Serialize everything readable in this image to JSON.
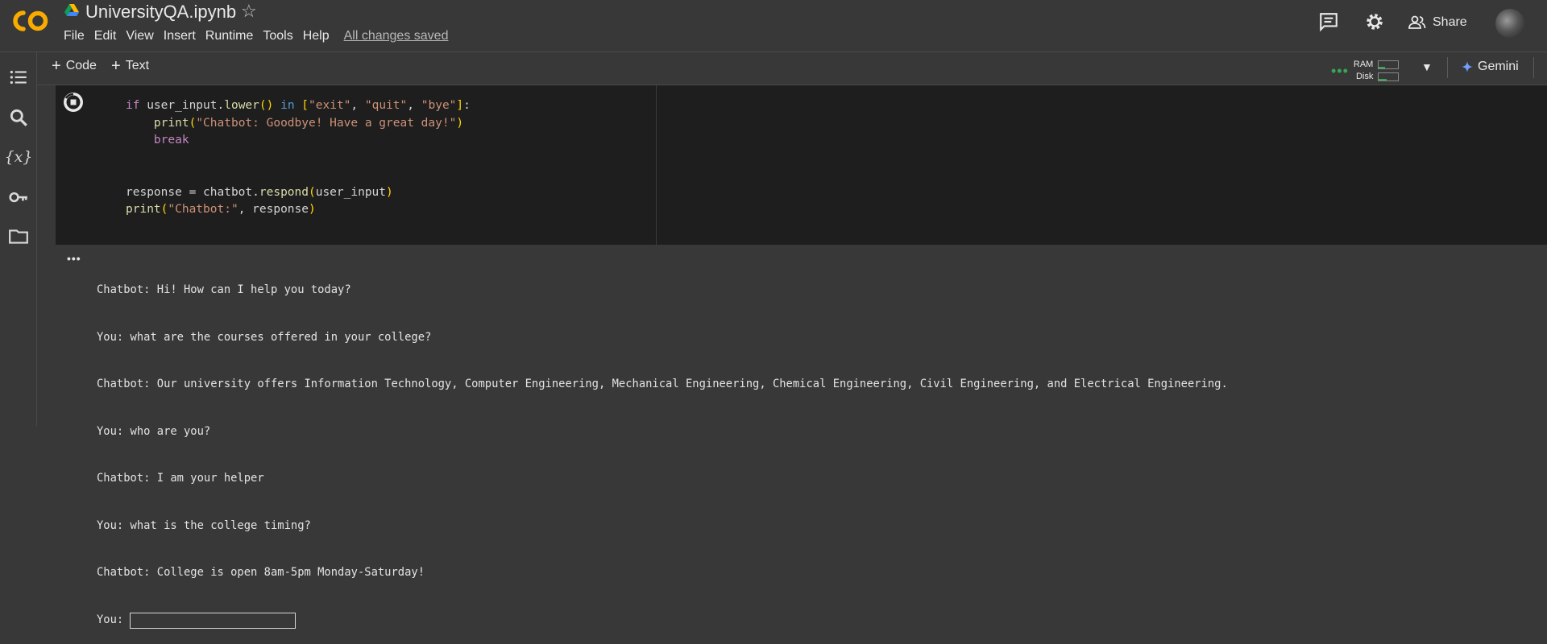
{
  "header": {
    "title": "UniversityQA.ipynb",
    "menu": [
      "File",
      "Edit",
      "View",
      "Insert",
      "Runtime",
      "Tools",
      "Help"
    ],
    "save_status": "All changes saved",
    "share_label": "Share"
  },
  "toolbar": {
    "add_code": "Code",
    "add_text": "Text",
    "ram_label": "RAM",
    "disk_label": "Disk",
    "gemini_label": "Gemini"
  },
  "cell": {
    "code_lines": [
      "if user_input.lower() in [\"exit\", \"quit\", \"bye\"]:",
      "    print(\"Chatbot: Goodbye! Have a great day!\")",
      "    break",
      "",
      "",
      "response = chatbot.respond(user_input)",
      "print(\"Chatbot:\", response)"
    ]
  },
  "output": {
    "lines": [
      "Chatbot: Hi! How can I help you today?",
      "You: what are the courses offered in your college?",
      "Chatbot: Our university offers Information Technology, Computer Engineering, Mechanical Engineering, Chemical Engineering, Civil Engineering, and Electrical Engineering.",
      "You: who are you?",
      "Chatbot: I am your helper",
      "You: what is the college timing?",
      "Chatbot: College is open 8am-5pm Monday-Saturday!"
    ],
    "prompt": "You:",
    "input_value": ""
  },
  "colors": {
    "background": "#383838",
    "cell_background": "#1e1e1e",
    "logo_orange": "#f9ab00",
    "status_green": "#34a853"
  }
}
